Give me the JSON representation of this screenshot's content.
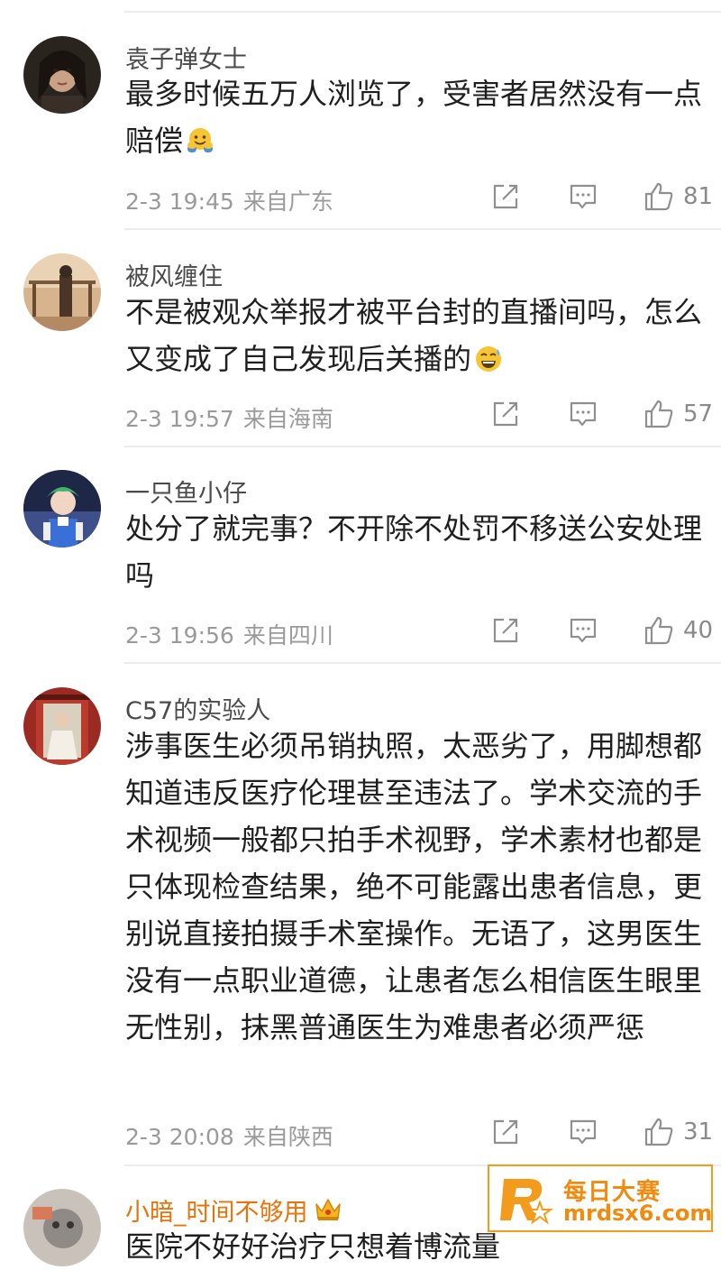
{
  "comments": [
    {
      "username": "袁子弹女士",
      "text": "最多时候五万人浏览了，受害者居然没有一点赔偿",
      "time": "2-3 19:45",
      "location": "来自广东",
      "likes": "81",
      "emoji": "hugging-face"
    },
    {
      "username": "被风缠住",
      "text": "不是被观众举报才被平台封的直播间吗，怎么又变成了自己发现后关播的",
      "time": "2-3 19:57",
      "location": "来自海南",
      "likes": "57",
      "emoji": "sweat-smile-face"
    },
    {
      "username": "一只鱼小仔",
      "text": "处分了就完事？不开除不处罚不移送公安处理吗",
      "time": "2-3 19:56",
      "location": "来自四川",
      "likes": "40"
    },
    {
      "username": "C57的实验人",
      "text": "涉事医生必须吊销执照，太恶劣了，用脚想都知道违反医疗伦理甚至违法了。学术交流的手术视频一般都只拍手术视野，学术素材也都是只体现检查结果，绝不可能露出患者信息，更别说直接拍摄手术室操作。无语了，这男医生没有一点职业道德，让患者怎么相信医生眼里无性别，抹黑普通医生为难患者必须严惩",
      "time": "2-3 20:08",
      "location": "来自陕西",
      "likes": "31"
    },
    {
      "username": "小暗_时间不够用",
      "text": "医院不好好治疗只想着博流量",
      "badge": "crown-icon"
    }
  ],
  "watermark": {
    "title": "每日大赛",
    "domain": "mrdsx6.com",
    "brand_color": "#f08b0f"
  },
  "icons": {
    "share": "share-edit-icon",
    "reply": "comment-bubble-icon",
    "like": "thumbs-up-icon"
  }
}
